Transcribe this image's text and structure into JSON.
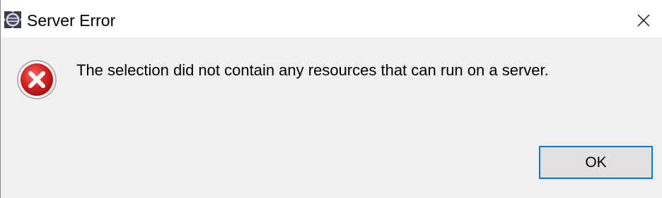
{
  "window": {
    "title": "Server Error",
    "app_icon": "eclipse-app-icon",
    "close_icon": "close-icon"
  },
  "dialog": {
    "icon": "error-icon",
    "message": "The selection did not contain any resources that can run on a server."
  },
  "buttons": {
    "ok_label": "OK"
  },
  "colors": {
    "title_bar": "#ffffff",
    "dialog_background": "#f0f0f0",
    "error_red": "#d42020",
    "button_focus_border": "#0078d7",
    "button_face": "#e1e1e1"
  }
}
